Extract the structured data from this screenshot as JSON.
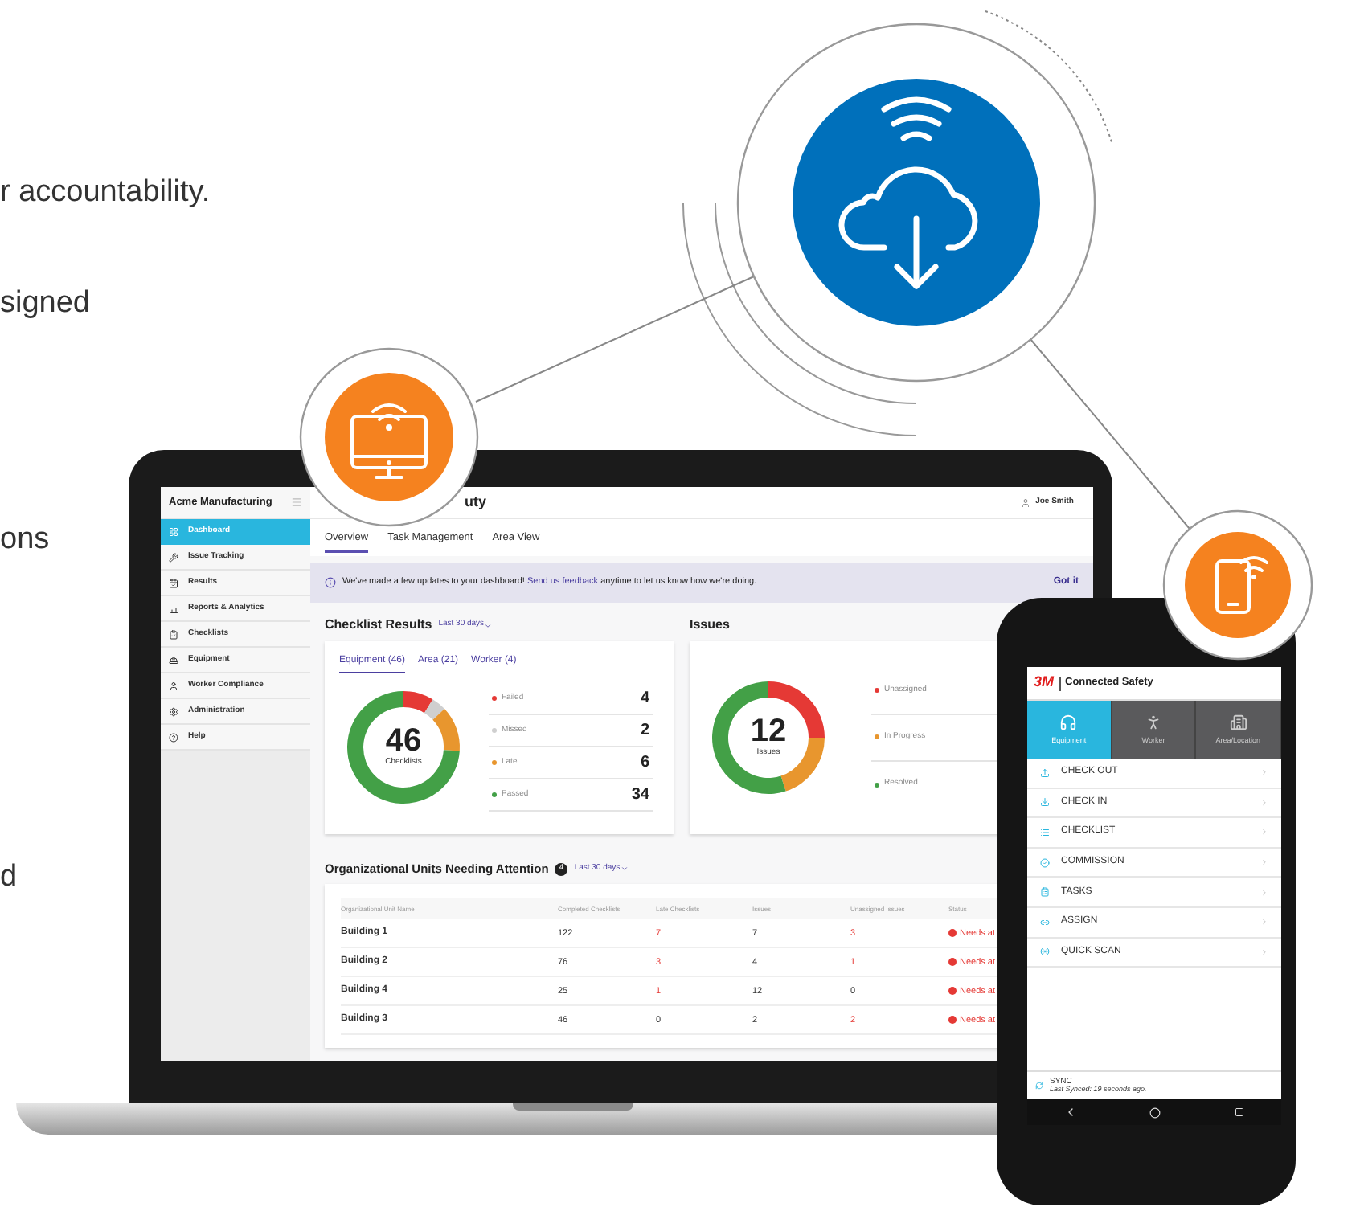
{
  "intro_fragments": [
    "r accountability.",
    "signed",
    "ons",
    "d"
  ],
  "laptop": {
    "sidebar": {
      "title": "Acme Manufacturing",
      "items": [
        {
          "label": "Dashboard",
          "selected": true
        },
        {
          "label": "Issue Tracking",
          "selected": false
        },
        {
          "label": "Results",
          "selected": false
        },
        {
          "label": "Reports & Analytics",
          "selected": false
        },
        {
          "label": "Checklists",
          "selected": false
        },
        {
          "label": "Equipment",
          "selected": false
        },
        {
          "label": "Worker Compliance",
          "selected": false
        },
        {
          "label": "Administration",
          "selected": false
        },
        {
          "label": "Help",
          "selected": false
        }
      ]
    },
    "header": {
      "title": "uty",
      "user": "Joe Smith"
    },
    "tabs": [
      {
        "label": "Overview",
        "selected": true
      },
      {
        "label": "Task Management",
        "selected": false
      },
      {
        "label": "Area View",
        "selected": false
      }
    ],
    "banner": {
      "text": "We've made a few updates to your dashboard! ",
      "link": "Send us feedback",
      "text_after": " anytime to let us know how we're doing.",
      "dismiss": "Got it"
    },
    "checklist_results": {
      "title": "Checklist Results",
      "period": "Last 30 days",
      "tabs": [
        {
          "label": "Equipment (46)",
          "selected": true
        },
        {
          "label": "Area (21)",
          "selected": false
        },
        {
          "label": "Worker (4)",
          "selected": false
        }
      ],
      "total": "46",
      "total_label": "Checklists",
      "legend": [
        {
          "value": "4",
          "color": "#e53935"
        },
        {
          "value": "2",
          "color": "#cfcfcf"
        },
        {
          "value": "6",
          "color": "#e8962e"
        },
        {
          "value": "34",
          "color": "#43a047"
        }
      ],
      "chart_data": {
        "type": "donut",
        "categories": [
          "Failed",
          "Missed",
          "Late",
          "Passed"
        ],
        "values": [
          8.7,
          4.3,
          13,
          74
        ]
      }
    },
    "issues": {
      "title": "Issues",
      "total": "12",
      "total_label": "Issues",
      "legend": [
        {
          "label": "Unassigned",
          "color": "#e53935"
        },
        {
          "label": "In Progress",
          "color": "#e8962e"
        },
        {
          "label": "Resolved",
          "color": "#43a047"
        }
      ]
    },
    "org_units": {
      "title": "Organizational Units Needing Attention",
      "count": "4",
      "period": "Last 30 days",
      "columns": [
        "Organizational Unit Name",
        "Completed Checklists",
        "Late Checklists",
        "Issues",
        "Unassigned Issues",
        "Status"
      ],
      "rows": [
        {
          "cells": [
            {
              "text": "Building 1",
              "alert": false
            },
            {
              "text": "122",
              "alert": false
            },
            {
              "text": "7",
              "alert": true
            },
            {
              "text": "7",
              "alert": false
            },
            {
              "text": "3",
              "alert": true
            },
            {
              "text": "Needs at",
              "alert": true
            }
          ]
        },
        {
          "cells": [
            {
              "text": "Building 2",
              "alert": false
            },
            {
              "text": "76",
              "alert": false
            },
            {
              "text": "3",
              "alert": true
            },
            {
              "text": "4",
              "alert": false
            },
            {
              "text": "1",
              "alert": true
            },
            {
              "text": "Needs at",
              "alert": true
            }
          ]
        },
        {
          "cells": [
            {
              "text": "Building 4",
              "alert": false
            },
            {
              "text": "25",
              "alert": false
            },
            {
              "text": "1",
              "alert": true
            },
            {
              "text": "12",
              "alert": false
            },
            {
              "text": "0",
              "alert": false
            },
            {
              "text": "Needs at",
              "alert": true
            }
          ]
        },
        {
          "cells": [
            {
              "text": "Building 3",
              "alert": false
            },
            {
              "text": "46",
              "alert": false
            },
            {
              "text": "0",
              "alert": false
            },
            {
              "text": "2",
              "alert": false
            },
            {
              "text": "2",
              "alert": true
            },
            {
              "text": "Needs at",
              "alert": true
            }
          ]
        }
      ]
    }
  },
  "phone": {
    "brand": "3M",
    "app_title": "Connected Safety",
    "tabs": [
      {
        "label": "Equipment",
        "selected": true
      },
      {
        "label": "Worker",
        "selected": false
      },
      {
        "label": "Area/Location",
        "selected": false
      }
    ],
    "menu": [
      "CHECK OUT",
      "CHECK IN",
      "CHECKLIST",
      "COMMISSION",
      "TASKS",
      "ASSIGN",
      "QUICK SCAN"
    ],
    "sync": {
      "label": "SYNC",
      "status": "Last Synced: 19 seconds ago."
    }
  }
}
